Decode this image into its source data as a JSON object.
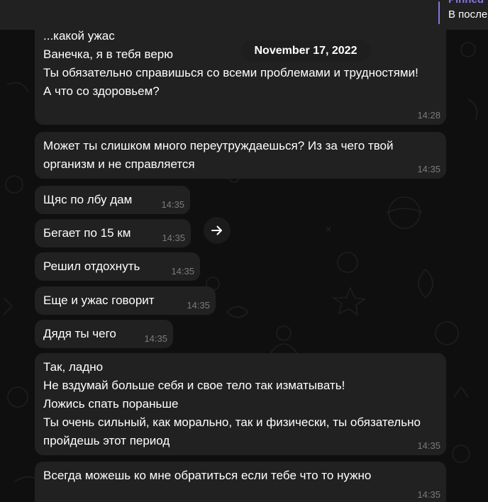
{
  "pinned": {
    "title": "Pinned",
    "text": "В после"
  },
  "date_separator": "November 17, 2022",
  "messages": [
    {
      "text": "...какой ужас\nВанечка, я в тебя верю\nТы обязательно справишься со всеми проблемами и трудностями!\nА что со здоровьем?",
      "time": "14:28"
    },
    {
      "text": "Может ты слишком много переутруждаешься? Из за чего твой организм и не справляется",
      "time": "14:35"
    },
    {
      "text": "Щяс по лбу дам",
      "time": "14:35"
    },
    {
      "text": "Бегает по 15 км",
      "time": "14:35"
    },
    {
      "text": "Решил отдохнуть",
      "time": "14:35"
    },
    {
      "text": "Еще и ужас говорит",
      "time": "14:35"
    },
    {
      "text": "Дядя ты чего",
      "time": "14:35"
    },
    {
      "text": "Так, ладно\nНе вздумай больше себя и свое тело так изматывать!\nЛожись спать пораньше\nТы очень сильный, как морально, так и физически, ты обязательно пройдешь этот период",
      "time": "14:35"
    },
    {
      "text": "Всегда можешь ко мне обратиться если тебе что то нужно",
      "time": "14:35"
    }
  ],
  "icons": {
    "forward": "arrow-right-icon"
  },
  "colors": {
    "background": "#0f0f0f",
    "bubble": "#212121",
    "time": "#7b7b7b",
    "accent": "#8774e1"
  }
}
